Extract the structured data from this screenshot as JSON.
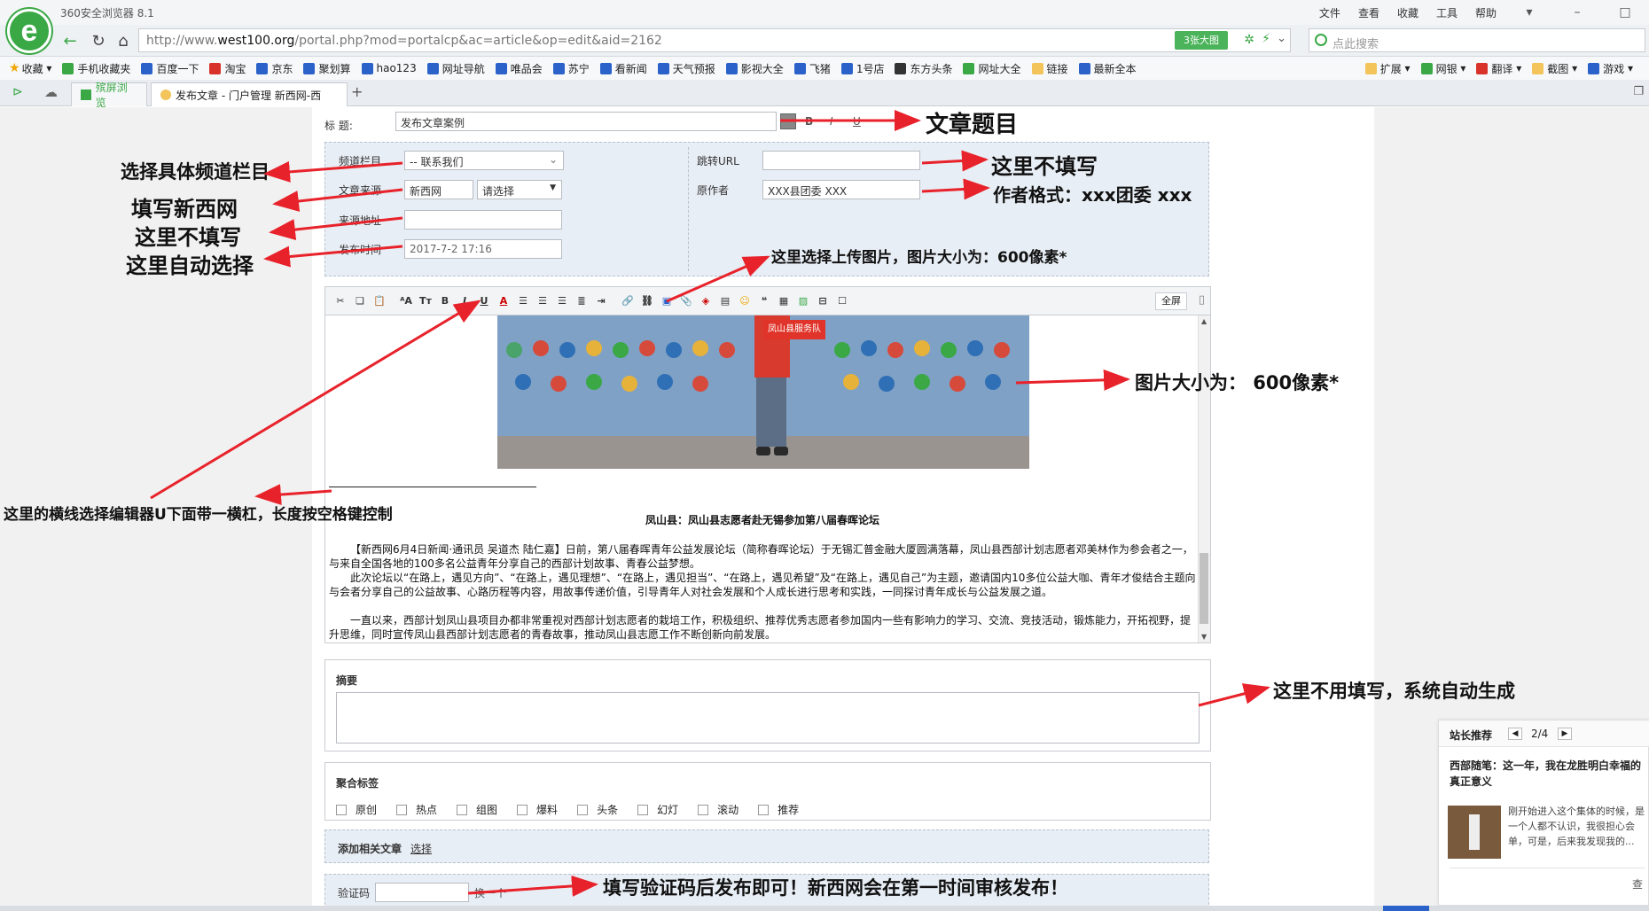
{
  "browser": {
    "name": "360安全浏览器 8.1",
    "menu": [
      "文件",
      "查看",
      "收藏",
      "工具",
      "帮助"
    ],
    "url_prefix": "http://www.",
    "url_domain": "west100.org",
    "url_path": "/portal.php?mod=portalcp&ac=article&op=edit&aid=2162",
    "bigimg_label": "3张大图",
    "search_placeholder": "点此搜索",
    "bookmarks": [
      "收藏",
      "手机收藏夹",
      "百度一下",
      "淘宝",
      "京东",
      "聚划算",
      "hao123",
      "网址导航",
      "唯品会",
      "苏宁",
      "看新闻",
      "天气预报",
      "影视大全",
      "飞猪",
      "1号店",
      "东方头条",
      "网址大全",
      "链接",
      "最新全本"
    ],
    "bookmarks_right": [
      "扩展",
      "网银",
      "翻译",
      "截图",
      "游戏"
    ],
    "tabs": [
      "殡屏浏览",
      "发布文章 - 门户管理 新西网-西"
    ]
  },
  "form": {
    "title_label": "标  题:",
    "title_value": "发布文章案例",
    "channel_label": "频道栏目",
    "channel_value": "-- 联系我们",
    "source_label": "文章来源",
    "source_value": "新西网",
    "source_select": "请选择",
    "source_url_label": "来源地址",
    "publish_time_label": "发布时间",
    "publish_time_value": "2017-7-2 17:16",
    "redirect_label": "跳转URL",
    "author_label": "原作者",
    "author_value": "XXX县团委  XXX",
    "fullscreen_label": "全屏",
    "summary_label": "摘要",
    "tags_label": "聚合标签",
    "tags": [
      "原创",
      "热点",
      "组图",
      "爆料",
      "头条",
      "幻灯",
      "滚动",
      "推荐"
    ],
    "related_label": "添加相关文章",
    "related_link": "选择",
    "captcha_label": "验证码",
    "captcha_next": "换一个"
  },
  "article": {
    "banner_text": "凤山县服务队",
    "heading": "凤山县：凤山县志愿者赴无锡参加第八届春晖论坛",
    "paragraphs": [
      "【新西网6月4日新闻·通讯员 吴道杰 陆仁嘉】日前，第八届春晖青年公益发展论坛（简称春晖论坛）于无锡汇普金融大厦圆满落幕，凤山县西部计划志愿者邓美林作为参会者之一，与来自全国各地的100多名公益青年分享自己的西部计划故事、青春公益梦想。",
      "此次论坛以“在路上，遇见方向”、“在路上，遇见理想”、“在路上，遇见担当”、“在路上，遇见希望”及“在路上，遇见自己”为主题，邀请国内10多位公益大咖、青年才俊结合主题向与会者分享自己的公益故事、心路历程等内容，用故事传递价值，引导青年人对社会发展和个人成长进行思考和实践，一同探讨青年成长与公益发展之道。",
      "一直以来，西部计划凤山县项目办都非常重视对西部计划志愿者的栽培工作，积极组织、推荐优秀志愿者参加国内一些有影响力的学习、交流、竞技活动，锻炼能力，开拓视野，提升思维，同时宣传凤山县西部计划志愿者的青春故事，推动凤山县志愿工作不断创新向前发展。"
    ]
  },
  "annotations": {
    "title": "文章题目",
    "channel": "选择具体频道栏目",
    "source": "填写新西网",
    "source_url": "这里不填写",
    "publish_time": "这里自动选择",
    "redirect": "这里不填写",
    "author": "作者格式：xxx团委 xxx",
    "upload": "这里选择上传图片，图片大小为：600像素*",
    "image_size": "图片大小为： 600像素*",
    "underline": "这里的横线选择编辑器U下面带一横杠，长度按空格键控制",
    "summary": "这里不用填写，系统自动生成",
    "captcha": "填写验证码后发布即可！新西网会在第一时间审核发布！"
  },
  "sidebar": {
    "title": "站长推荐",
    "pager": "2/4",
    "headline": "西部随笔：这一年，我在龙胜明白幸福的真正意义",
    "excerpt": "刚开始进入这个集体的时候，是一个人都不认识，我很担心会单，可是，后来我发现我的...",
    "more": "查"
  },
  "colors": {
    "accent_green": "#3aa845",
    "arrow_red": "#e8222a",
    "panel_bg": "#e8eef5"
  }
}
